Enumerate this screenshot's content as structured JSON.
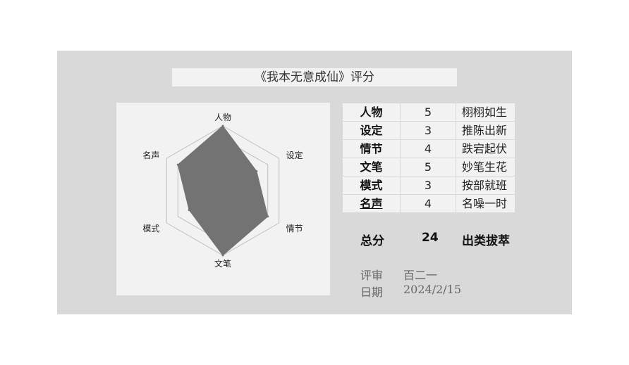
{
  "title": "《我本无意成仙》评分",
  "chart_data": {
    "type": "radar",
    "categories": [
      "人物",
      "设定",
      "情节",
      "文笔",
      "模式",
      "名声"
    ],
    "values": [
      5,
      3,
      4,
      5,
      3,
      4
    ],
    "rmax": 5,
    "grid_levels": [
      1,
      2,
      3,
      4,
      5
    ],
    "grid": true
  },
  "table": {
    "rows": [
      {
        "category": "人物",
        "score": "5",
        "comment": "栩栩如生"
      },
      {
        "category": "设定",
        "score": "3",
        "comment": "推陈出新"
      },
      {
        "category": "情节",
        "score": "4",
        "comment": "跌宕起伏"
      },
      {
        "category": "文笔",
        "score": "5",
        "comment": "妙笔生花"
      },
      {
        "category": "模式",
        "score": "3",
        "comment": "按部就班"
      },
      {
        "category": "名声",
        "score": "4",
        "comment": "名噪一时"
      }
    ]
  },
  "total": {
    "label": "总分",
    "value": "24",
    "comment": "出类拔萃"
  },
  "meta": {
    "reviewer_label": "评审",
    "reviewer": "百二一",
    "date_label": "日期",
    "date": "2024/2/15"
  },
  "colors": {
    "fill": "#737373",
    "grid": "#bfbfbf",
    "panel": "#d9d9d9",
    "box": "#f2f2f2"
  }
}
